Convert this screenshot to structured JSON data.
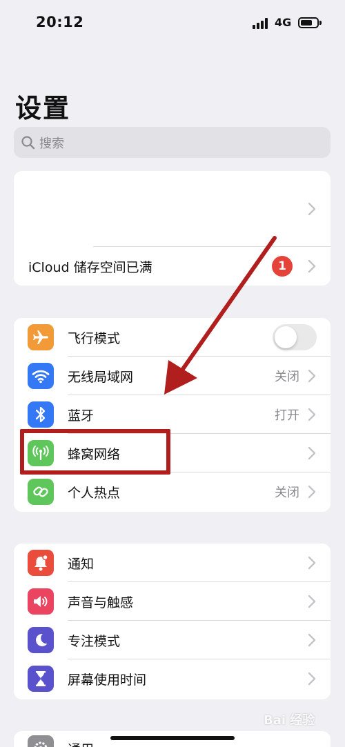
{
  "status_bar": {
    "time": "20:12",
    "network": "4G"
  },
  "page": {
    "title": "设置"
  },
  "search": {
    "placeholder": "搜索"
  },
  "account_section": {
    "rows": [
      {
        "label": ""
      },
      {
        "label": "iCloud 储存空间已满",
        "badge": "1"
      }
    ]
  },
  "connectivity_section": {
    "rows": [
      {
        "label": "飞行模式",
        "value": "",
        "toggle": false
      },
      {
        "label": "无线局域网",
        "value": "关闭"
      },
      {
        "label": "蓝牙",
        "value": "打开"
      },
      {
        "label": "蜂窝网络",
        "value": ""
      },
      {
        "label": "个人热点",
        "value": "关闭"
      }
    ]
  },
  "notification_section": {
    "rows": [
      {
        "label": "通知"
      },
      {
        "label": "声音与触感"
      },
      {
        "label": "专注模式"
      },
      {
        "label": "屏幕使用时间"
      }
    ]
  },
  "general_section": {
    "rows": [
      {
        "label": "通用"
      }
    ]
  },
  "colors": {
    "airplane": "#f19a37",
    "wifi": "#3478f6",
    "bluetooth": "#3478f6",
    "cellular": "#5fc65b",
    "hotspot": "#5fc65b",
    "notifications": "#eb4d3d",
    "sounds": "#eb4461",
    "focus": "#5a52cc",
    "screen_time": "#5a52cc",
    "general": "#8e8e93",
    "annotation": "#b01e1e"
  },
  "watermark": {
    "text": "Bai 经验"
  }
}
